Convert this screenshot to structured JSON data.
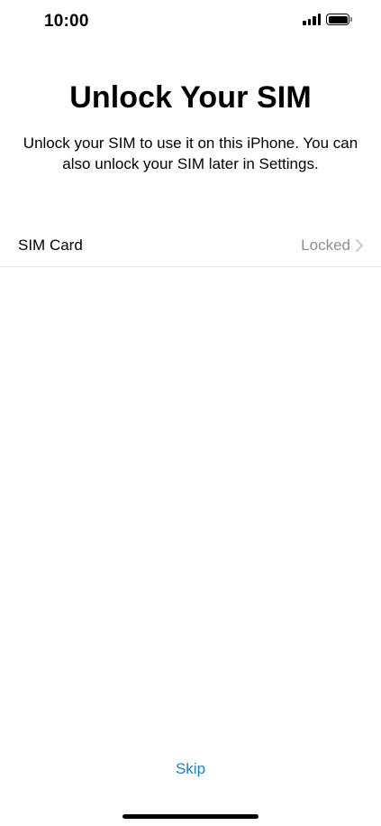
{
  "status_bar": {
    "time": "10:00",
    "icons": [
      "cellular-signal-icon",
      "battery-icon"
    ]
  },
  "header": {
    "title": "Unlock Your SIM",
    "subtitle": "Unlock your SIM to use it on this iPhone. You can also unlock your SIM later in Settings."
  },
  "sim_row": {
    "label": "SIM Card",
    "value": "Locked",
    "icon": "chevron-right-icon"
  },
  "footer": {
    "skip_label": "Skip"
  },
  "colors": {
    "accent": "#1a7fd4",
    "secondary_text": "#8e8e93",
    "divider": "#e4e4e7",
    "background": "#ffffff"
  }
}
